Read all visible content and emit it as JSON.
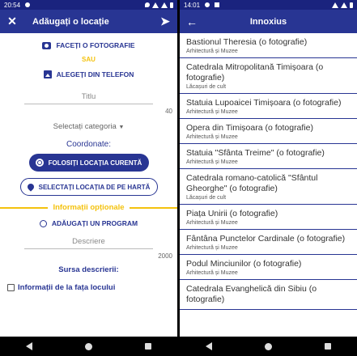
{
  "left": {
    "status": {
      "time": "20:54"
    },
    "appbar": {
      "title": "Adăugați o locație"
    },
    "photo": {
      "take": "FACEȚI O FOTOGRAFIE",
      "or": "SAU",
      "choose": "ALEGEȚI DIN TELEFON"
    },
    "title_field": {
      "placeholder": "Titlu",
      "counter": "40"
    },
    "category": {
      "label": "Selectați categoria"
    },
    "coordinates": {
      "label": "Coordonate:",
      "current": "FOLOSIȚI LOCAȚIA CURENTĂ",
      "map": "SELECTAȚI LOCAȚIA DE PE HARTĂ"
    },
    "optional": {
      "header": "Informații opționale",
      "add_program": "ADĂUGAȚI UN PROGRAM"
    },
    "description": {
      "placeholder": "Descriere",
      "counter": "2000"
    },
    "source": {
      "label": "Sursa descrierii:",
      "onsite": "Informații de la fața locului"
    }
  },
  "right": {
    "status": {
      "time": "14:01"
    },
    "appbar": {
      "title": "Innoxius"
    },
    "items": [
      {
        "title": "Bastionul Theresia (o fotografie)",
        "category": "Arhitectură și Muzee"
      },
      {
        "title": "Catedrala Mitropolitană Timișoara (o fotografie)",
        "category": "Lăcașuri de cult"
      },
      {
        "title": "Statuia Lupoaicei Timișoara (o fotografie)",
        "category": "Arhitectură și Muzee"
      },
      {
        "title": "Opera din Timișoara (o fotografie)",
        "category": "Arhitectură și Muzee"
      },
      {
        "title": "Statuia \"Sfânta Treime\" (o fotografie)",
        "category": "Arhitectură și Muzee"
      },
      {
        "title": "Catedrala romano-catolică \"Sfântul Gheorghe\" (o fotografie)",
        "category": "Lăcașuri de cult"
      },
      {
        "title": "Piața Unirii (o fotografie)",
        "category": "Arhitectură și Muzee"
      },
      {
        "title": "Fântâna Punctelor Cardinale (o fotografie)",
        "category": "Arhitectură și Muzee"
      },
      {
        "title": "Podul Minciunilor (o fotografie)",
        "category": "Arhitectură și Muzee"
      },
      {
        "title": "Catedrala Evanghelică din Sibiu (o fotografie)",
        "category": ""
      }
    ]
  }
}
